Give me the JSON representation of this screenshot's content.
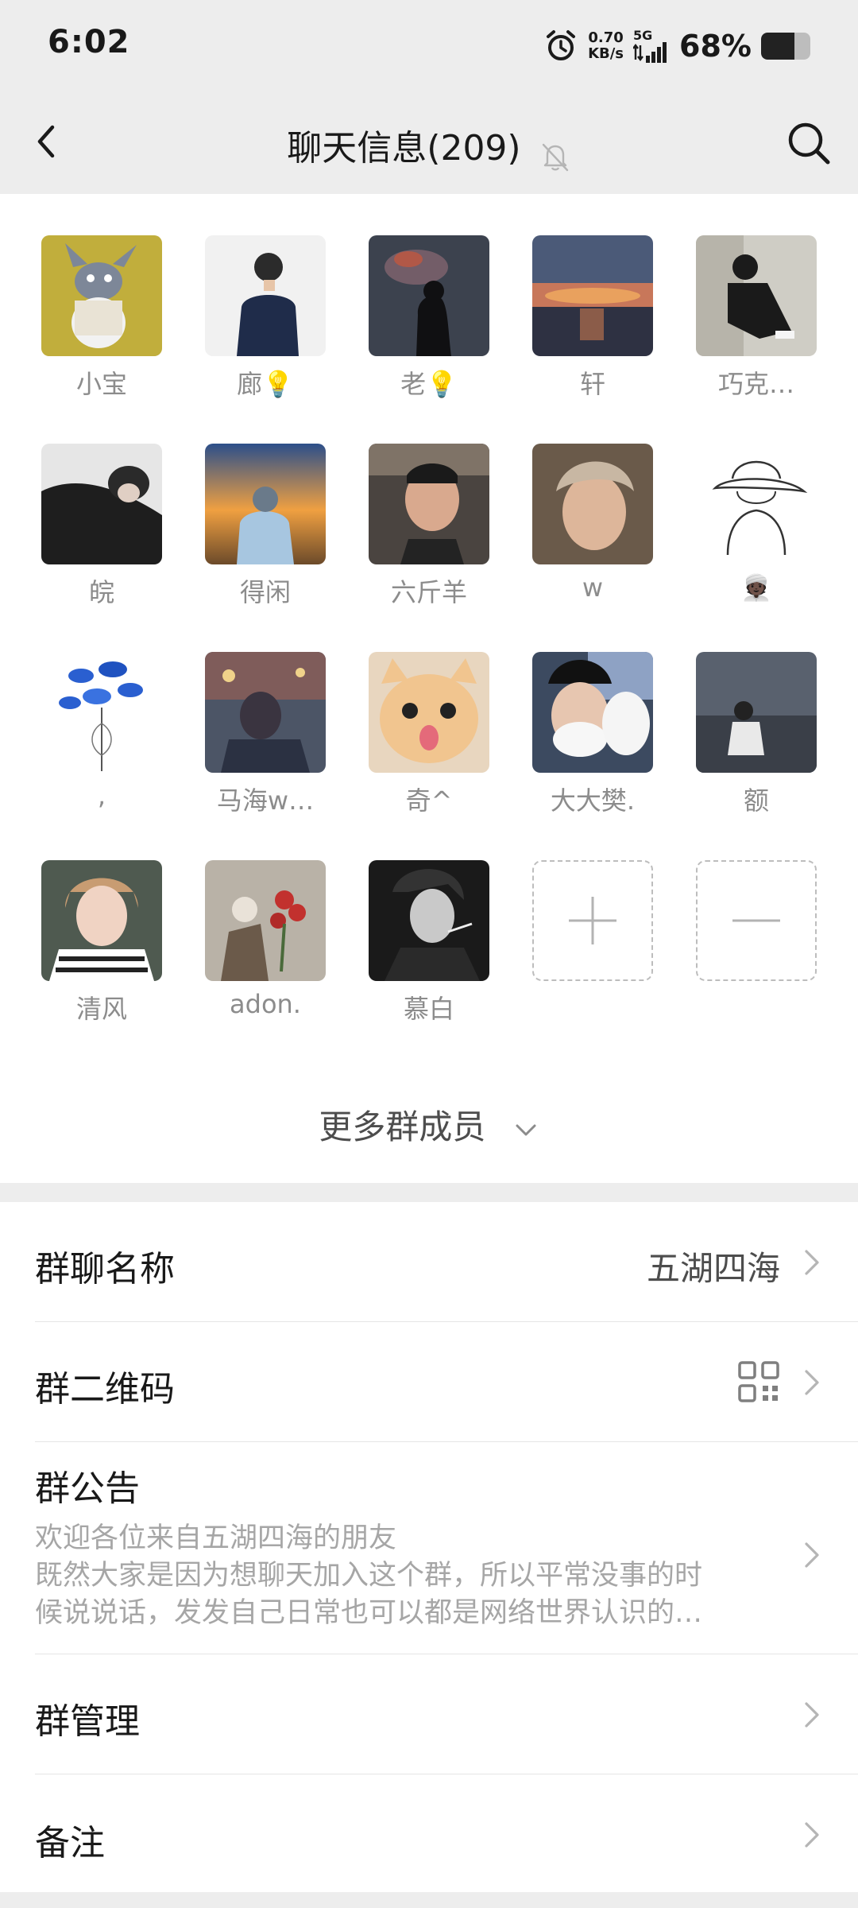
{
  "status_bar": {
    "time": "6:02",
    "speed_value": "0.70",
    "speed_unit": "KB/s",
    "network": "5G",
    "battery_percent": "68%",
    "battery_level": 0.68
  },
  "header": {
    "title": "聊天信息(209)",
    "back_icon": "back-icon",
    "mute_icon": "bell-muted-icon",
    "search_icon": "search-icon"
  },
  "members": [
    {
      "name": "小宝",
      "avatar": "cartoon-cat"
    },
    {
      "name": "廊💡",
      "avatar": "man-phone"
    },
    {
      "name": "老💡",
      "avatar": "silhouette-smoke"
    },
    {
      "name": "轩",
      "avatar": "sunset-sea"
    },
    {
      "name": "巧克…",
      "avatar": "sitting-person"
    },
    {
      "name": "皖",
      "avatar": "dark-portrait"
    },
    {
      "name": "得闲",
      "avatar": "sunset-hiker"
    },
    {
      "name": "六斤羊",
      "avatar": "selfie-car"
    },
    {
      "name": "w",
      "avatar": "curly-hair"
    },
    {
      "name": "👳🏿",
      "avatar": "line-drawing-hat"
    },
    {
      "name": ",",
      "avatar": "blue-fish-art"
    },
    {
      "name": "马海w…",
      "avatar": "street-night"
    },
    {
      "name": "奇^",
      "avatar": "cat-tongue"
    },
    {
      "name": "大大樊.",
      "avatar": "foam-face"
    },
    {
      "name": "额",
      "avatar": "night-city"
    },
    {
      "name": "清风",
      "avatar": "striped-shirt"
    },
    {
      "name": "adon.",
      "avatar": "flowers"
    },
    {
      "name": "慕白",
      "avatar": "bw-smoke"
    }
  ],
  "controls": {
    "add_icon": "plus-icon",
    "remove_icon": "minus-icon"
  },
  "more_members": "更多群成员",
  "settings": {
    "group_name_label": "群聊名称",
    "group_name_value": "五湖四海",
    "qrcode_label": "群二维码",
    "notice_label": "群公告",
    "notice_lines": [
      "欢迎各位来自五湖四海的朋友",
      "既然大家是因为想聊天加入这个群，所以平常没事的时",
      "候说说话，发发自己日常也可以都是网络世界认识的…"
    ],
    "manage_label": "群管理",
    "remark_label": "备注"
  }
}
